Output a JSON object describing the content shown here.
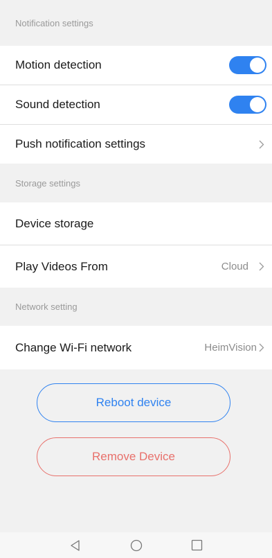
{
  "sections": {
    "notification": {
      "title": "Notification settings",
      "motion_label": "Motion detection",
      "motion_enabled": true,
      "sound_label": "Sound detection",
      "sound_enabled": true,
      "push_label": "Push notification settings"
    },
    "storage": {
      "title": "Storage settings",
      "device_storage_label": "Device storage",
      "play_from_label": "Play Videos From",
      "play_from_value": "Cloud"
    },
    "network": {
      "title": "Network setting",
      "wifi_label": "Change Wi-Fi network",
      "wifi_value": "HeimVision"
    }
  },
  "actions": {
    "reboot_label": "Reboot device",
    "remove_label": "Remove Device"
  },
  "colors": {
    "accent": "#2f82f0",
    "danger": "#e8706b",
    "background": "#f1f1f1"
  },
  "navbar": {
    "icons": [
      "back-icon",
      "home-icon",
      "recents-icon"
    ]
  }
}
